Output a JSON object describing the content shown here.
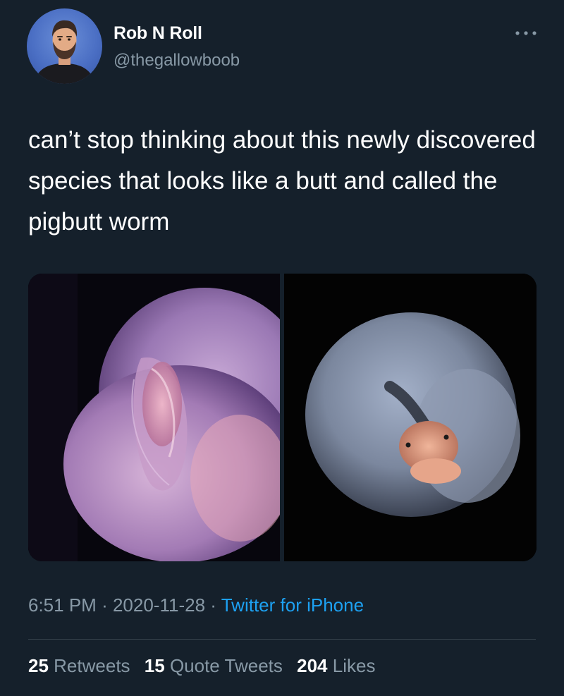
{
  "user": {
    "display_name": "Rob N Roll",
    "handle": "@thegallowboob"
  },
  "tweet": {
    "text": "can’t stop thinking about this newly discovered species that looks like a butt and called the pigbutt worm"
  },
  "meta": {
    "time": "6:51 PM",
    "date": "2020-11-28",
    "separator": "·",
    "source": "Twitter for iPhone"
  },
  "stats": {
    "retweets_count": "25",
    "retweets_label": "Retweets",
    "quotes_count": "15",
    "quotes_label": "Quote Tweets",
    "likes_count": "204",
    "likes_label": "Likes"
  },
  "icons": {
    "more": "more-horizontal-icon"
  },
  "colors": {
    "background": "#15202b",
    "primary_text": "#ffffff",
    "secondary_text": "#8899a6",
    "link": "#1da1f2",
    "divider": "#38444d"
  }
}
